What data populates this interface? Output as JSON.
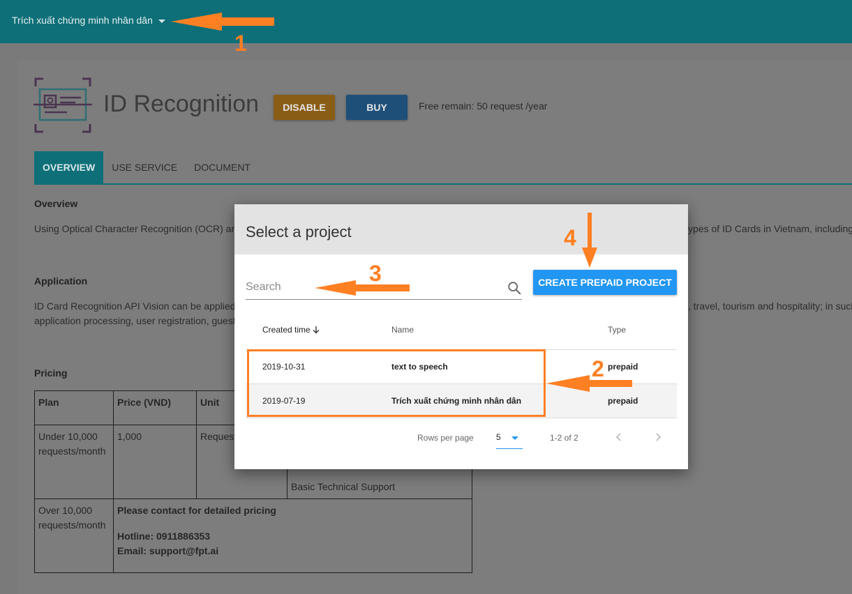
{
  "header": {
    "project_name": "Trích xuất chứng minh nhân dân"
  },
  "service": {
    "title": "ID Recognition",
    "disable_label": "DISABLE",
    "buy_label": "BUY",
    "free_remain": "Free remain: 50 request /year"
  },
  "tabs": [
    {
      "label": "OVERVIEW",
      "active": true
    },
    {
      "label": "USE SERVICE",
      "active": false
    },
    {
      "label": "DOCUMENT",
      "active": false
    }
  ],
  "overview": {
    "heading": "Overview",
    "text_left": "Using Optical Character Recognition (OCR) and",
    "text_right": "ypes of ID Cards in Vietnam, including o"
  },
  "application": {
    "heading": "Application",
    "line1_left": "ID Card Recognition API Vision can be applied",
    "line1_right": ", travel, tourism and hospitality; in such",
    "line2_left": "application processing, user registration, guest"
  },
  "pricing": {
    "heading": "Pricing",
    "headers": [
      "Plan",
      "Price (VND)",
      "Unit",
      ""
    ],
    "row1": {
      "plan": "Under 10,000 requests/month",
      "price": "1,000",
      "unit": "Request",
      "support": "Basic Technical Support"
    },
    "row2": {
      "plan": "Over 10,000 requests/month",
      "contact": "Please contact for detailed pricing",
      "hotline": "Hotline: 0911886353",
      "email": "Email: support@fpt.ai"
    }
  },
  "modal": {
    "title": "Select a project",
    "search_placeholder": "Search",
    "create_label": "CREATE PREPAID PROJECT",
    "columns": {
      "created": "Created time",
      "name": "Name",
      "type": "Type"
    },
    "rows": [
      {
        "created": "2019-10-31",
        "name": "text to speech",
        "type": "prepaid"
      },
      {
        "created": "2019-07-19",
        "name": "Trích xuất chứng minh nhân dân",
        "type": "prepaid"
      }
    ],
    "pagination": {
      "rows_per_page_label": "Rows per page",
      "rows_per_page": "5",
      "range": "1-2 of 2"
    }
  },
  "annotations": {
    "n1": "1",
    "n2": "2",
    "n3": "3",
    "n4": "4"
  },
  "colors": {
    "topbar": "#0e6f78",
    "annotation": "#ff7f23",
    "primary_button": "#2196f3"
  }
}
